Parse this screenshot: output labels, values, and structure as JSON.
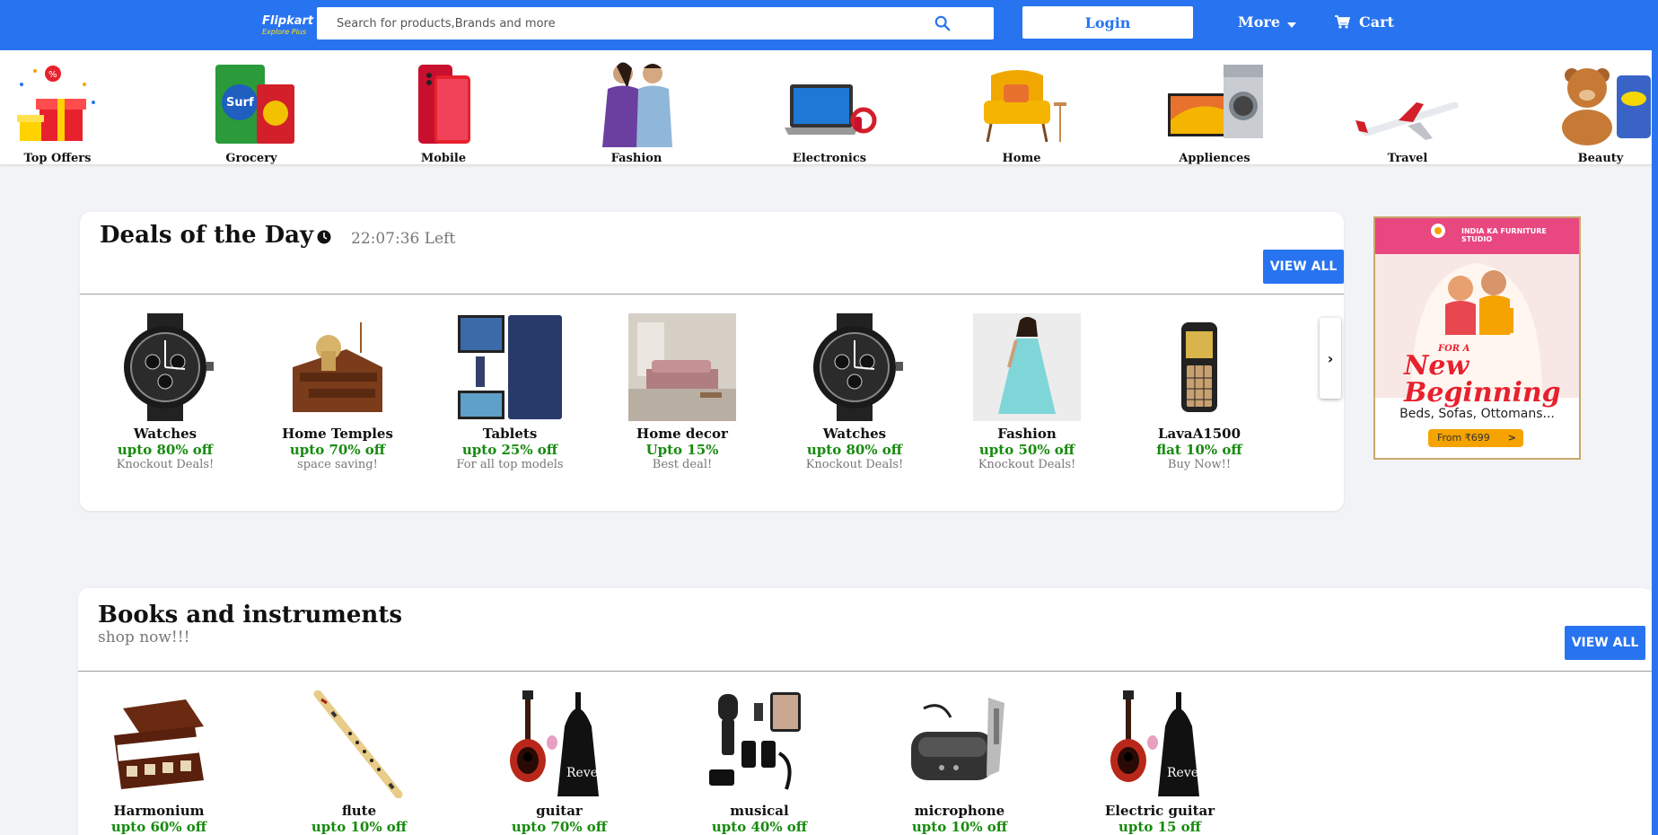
{
  "header": {
    "logo_text": "Flipkart",
    "logo_sub": "Explore Plus",
    "search_placeholder": "Search for products,Brands and more",
    "login_label": "Login",
    "more_label": "More",
    "cart_label": "Cart",
    "brand_color": "#2874f0"
  },
  "categories": [
    {
      "label": "Top Offers",
      "icon": "gift-box-icon"
    },
    {
      "label": "Grocery",
      "icon": "grocery-icon"
    },
    {
      "label": "Mobile",
      "icon": "mobile-phone-icon"
    },
    {
      "label": "Fashion",
      "icon": "fashion-icon"
    },
    {
      "label": "Electronics",
      "icon": "laptop-icon"
    },
    {
      "label": "Home",
      "icon": "armchair-icon"
    },
    {
      "label": "Appliences",
      "icon": "appliance-icon"
    },
    {
      "label": "Travel",
      "icon": "airplane-icon"
    },
    {
      "label": "Beauty",
      "icon": "teddy-bear-icon"
    }
  ],
  "deals": {
    "title": "Deals of the Day",
    "timer": "22:07:36 Left",
    "view_all": "VIEW ALL",
    "products": [
      {
        "name": "Watches",
        "discount": "upto 80% off",
        "tag": "Knockout Deals!"
      },
      {
        "name": "Home Temples",
        "discount": "upto 70% off",
        "tag": "space saving!"
      },
      {
        "name": "Tablets",
        "discount": "upto 25% off",
        "tag": "For all top models"
      },
      {
        "name": "Home decor",
        "discount": "Upto 15%",
        "tag": "Best deal!"
      },
      {
        "name": "Watches",
        "discount": "upto 80% off",
        "tag": "Knockout Deals!"
      },
      {
        "name": "Fashion",
        "discount": "upto 50% off",
        "tag": "Knockout Deals!"
      },
      {
        "name": "LavaA1500",
        "discount": "flat 10% off",
        "tag": "Buy Now!!"
      }
    ],
    "next_arrow": "›"
  },
  "ad": {
    "studio": "INDIA KA FURNITURE STUDIO",
    "for_a": "FOR A",
    "headline": "New Beginning",
    "description": "Beds, Sofas, Ottomans...",
    "price": "From ₹699",
    "arrow": ">"
  },
  "books": {
    "title": "Books and instruments",
    "subtitle": "shop now!!!",
    "view_all": "VIEW ALL",
    "products": [
      {
        "name": "Harmonium",
        "discount": "upto 60% off"
      },
      {
        "name": "flute",
        "discount": "upto 10% off"
      },
      {
        "name": "guitar",
        "discount": "upto 70% off"
      },
      {
        "name": "musical",
        "discount": "upto 40% off"
      },
      {
        "name": "microphone",
        "discount": "upto 10% off"
      },
      {
        "name": "Electric guitar",
        "discount": "upto 15 off"
      }
    ]
  },
  "colors": {
    "brand": "#2874f0",
    "discount": "#168a0e",
    "background": "#f1f3f6"
  }
}
